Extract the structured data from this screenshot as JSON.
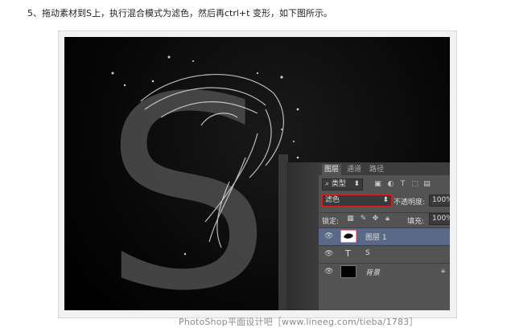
{
  "instruction": "5、拖动素材到S上，执行混合模式为滤色，然后再ctrl+t 变形，如下图所示。",
  "canvas": {
    "letter": "S"
  },
  "panel": {
    "tabs": [
      "图层",
      "通道",
      "路径"
    ],
    "filter_kind": "类型",
    "blend_mode": "滤色",
    "opacity_label": "不透明度:",
    "opacity_value": "100%",
    "lock_label": "锁定:",
    "fill_label": "填充:",
    "fill_value": "100%",
    "layers": [
      {
        "name": "图层 1",
        "type": "image",
        "selected": true
      },
      {
        "name": "S",
        "type": "text",
        "selected": false
      },
      {
        "name": "背景",
        "type": "background",
        "selected": false,
        "locked": true
      }
    ]
  },
  "watermark": "PhotoShop平面设计吧［www.lineeg.com/tieba/1783］",
  "colors": {
    "highlight": "#d42020",
    "panel_bg": "#535353",
    "selected_layer": "#5a6987"
  }
}
